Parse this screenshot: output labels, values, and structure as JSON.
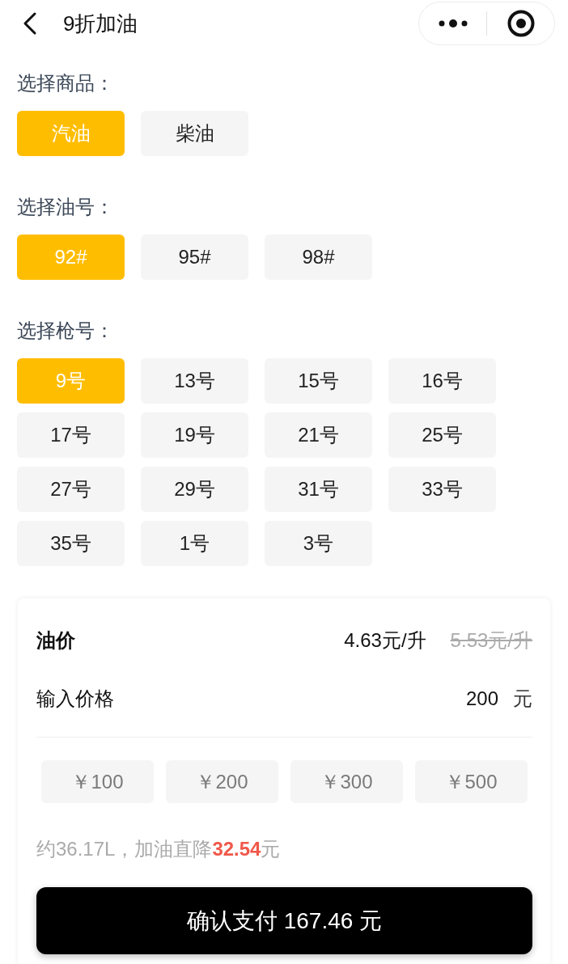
{
  "header": {
    "title": "9折加油"
  },
  "sections": [
    {
      "label": "选择商品：",
      "options": [
        {
          "label": "汽油",
          "selected": true
        },
        {
          "label": "柴油",
          "selected": false
        }
      ]
    },
    {
      "label": "选择油号：",
      "options": [
        {
          "label": "92#",
          "selected": true
        },
        {
          "label": "95#",
          "selected": false
        },
        {
          "label": "98#",
          "selected": false
        }
      ]
    },
    {
      "label": "选择枪号：",
      "options": [
        {
          "label": "9号",
          "selected": true
        },
        {
          "label": "13号",
          "selected": false
        },
        {
          "label": "15号",
          "selected": false
        },
        {
          "label": "16号",
          "selected": false
        },
        {
          "label": "17号",
          "selected": false
        },
        {
          "label": "19号",
          "selected": false
        },
        {
          "label": "21号",
          "selected": false
        },
        {
          "label": "25号",
          "selected": false
        },
        {
          "label": "27号",
          "selected": false
        },
        {
          "label": "29号",
          "selected": false
        },
        {
          "label": "31号",
          "selected": false
        },
        {
          "label": "33号",
          "selected": false
        },
        {
          "label": "35号",
          "selected": false
        },
        {
          "label": "1号",
          "selected": false
        },
        {
          "label": "3号",
          "selected": false
        }
      ]
    }
  ],
  "price_card": {
    "price_label": "油价",
    "current_price": "4.63元/升",
    "original_price": "5.53元/升",
    "amount_label": "输入价格",
    "amount_value": "200",
    "amount_unit": "元",
    "quick_amounts": [
      "￥100",
      "￥200",
      "￥300",
      "￥500"
    ],
    "summary": "约36.17L，加油直降**32.54**元"
  },
  "pay_button": "确认支付 167.46 元"
}
